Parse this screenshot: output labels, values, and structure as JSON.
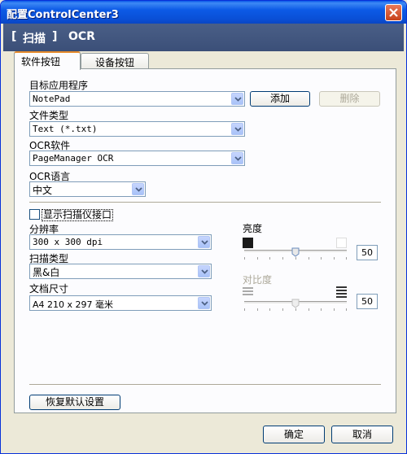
{
  "window": {
    "title": "配置ControlCenter3"
  },
  "header": {
    "section": "扫描",
    "bracket_open": "[",
    "bracket_close": "]",
    "subsection": "OCR"
  },
  "tabs": [
    {
      "label": "软件按钮",
      "active": true
    },
    {
      "label": "设备按钮",
      "active": false
    }
  ],
  "target_app": {
    "label": "目标应用程序",
    "value": "NotePad",
    "add_label": "添加",
    "delete_label": "删除"
  },
  "file_type": {
    "label": "文件类型",
    "value": "Text (*.txt)"
  },
  "ocr_software": {
    "label": "OCR软件",
    "value": "PageManager OCR"
  },
  "ocr_language": {
    "label": "OCR语言",
    "value": "中文"
  },
  "scanner_interface": {
    "label": "显示扫描仪接口",
    "checked": false
  },
  "resolution": {
    "label": "分辨率",
    "value": "300 x 300 dpi"
  },
  "scan_type": {
    "label": "扫描类型",
    "value": "黑&白"
  },
  "document_size": {
    "label": "文档尺寸",
    "value": "A4 210 x 297 毫米"
  },
  "brightness": {
    "label": "亮度",
    "value": "50"
  },
  "contrast": {
    "label": "对比度",
    "value": "50"
  },
  "buttons": {
    "restore_defaults": "恢复默认设置",
    "ok": "确定",
    "cancel": "取消"
  },
  "colors": {
    "title_bar": "#0a4fd6",
    "header_band": "#3b4f78",
    "face": "#ece9d8",
    "tab_accent": "#e68b2c"
  }
}
